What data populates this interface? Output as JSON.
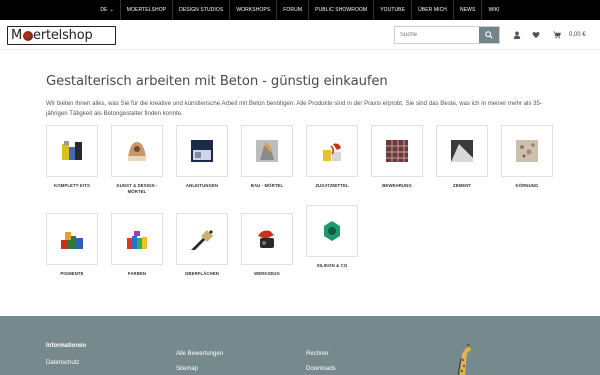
{
  "topnav": [
    {
      "label": "DE",
      "chevron": true
    },
    {
      "label": "MOERTELSHOP"
    },
    {
      "label": "DESIGN STUDIOS"
    },
    {
      "label": "WORKSHOPS"
    },
    {
      "label": "FORUM"
    },
    {
      "label": "PUBLIC SHOWROOM"
    },
    {
      "label": "YOUTUBE"
    },
    {
      "label": "ÜBER MICH"
    },
    {
      "label": "NEWS"
    },
    {
      "label": "WIKI"
    }
  ],
  "header": {
    "logo_text_pre": "M",
    "logo_text_post": "ertelshop",
    "search_placeholder": "Suche",
    "cart_price": "0,00 €"
  },
  "main": {
    "title": "Gestalterisch arbeiten mit Beton - günstig einkaufen",
    "intro": "Wir bieten Ihnen alles, was Sie für die kreative und künstlerische Arbeit mit Beton benötigen. Alle Produkte sind in der Praxis erprobt. Sie sind das Beste, was ich in meiner mehr als 35-jährigen Tätigkeit als Betongestalter finden konnte."
  },
  "categories": [
    {
      "label": "KOMPLETT-KITS"
    },
    {
      "label": "KUNST & DESIGN - MÖRTEL"
    },
    {
      "label": "ANLEITUNGEN"
    },
    {
      "label": "BAU - MÖRTEL"
    },
    {
      "label": "ZUSATZMITTEL"
    },
    {
      "label": "BEWEHRUNG"
    },
    {
      "label": "ZEMENT"
    },
    {
      "label": "KÖRNUNG"
    },
    {
      "label": "PIGMENTE"
    },
    {
      "label": "FARBEN"
    },
    {
      "label": "OBERFLÄCHEN"
    },
    {
      "label": "WERKZEUG"
    },
    {
      "label": "SILIKON & CO"
    }
  ],
  "footer": {
    "heading": "Informationen",
    "col1": [
      "Datenschutz"
    ],
    "col2": [
      "Alle Bewertungen",
      "Sitemap"
    ],
    "col3": [
      "Rechner",
      "Downloads"
    ]
  },
  "colors": {
    "topbar": "#000000",
    "footer": "#768a8e",
    "search_button": "#738489"
  }
}
